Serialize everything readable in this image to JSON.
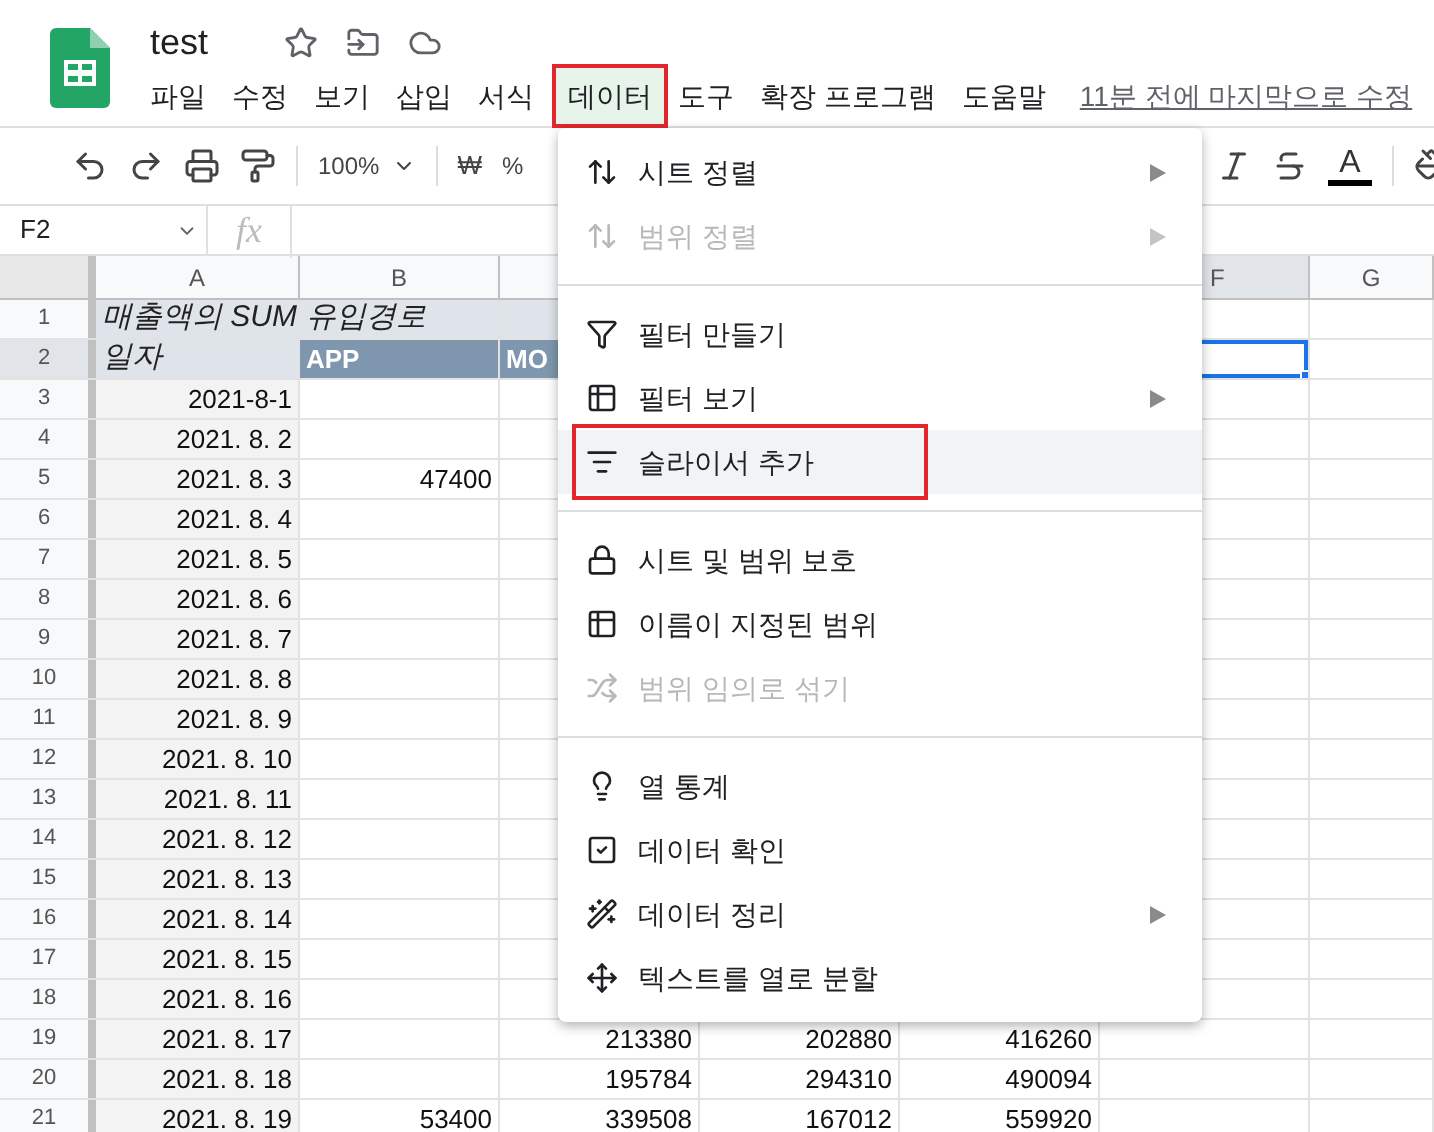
{
  "document": {
    "title": "test",
    "last_edit": "11분 전에 마지막으로 수정"
  },
  "menu_bar": [
    {
      "label": "파일",
      "selected": false,
      "outlined": false
    },
    {
      "label": "수정",
      "selected": false,
      "outlined": false
    },
    {
      "label": "보기",
      "selected": false,
      "outlined": false
    },
    {
      "label": "삽입",
      "selected": false,
      "outlined": false
    },
    {
      "label": "서식",
      "selected": false,
      "outlined": false
    },
    {
      "label": "데이터",
      "selected": true,
      "outlined": true
    },
    {
      "label": "도구",
      "selected": false,
      "outlined": false
    },
    {
      "label": "확장 프로그램",
      "selected": false,
      "outlined": false
    },
    {
      "label": "도움말",
      "selected": false,
      "outlined": false
    }
  ],
  "toolbar": {
    "zoom": "100%",
    "currency": "₩",
    "percent": "%",
    "text_color": "A"
  },
  "formula_bar": {
    "name_box": "F2",
    "fx": "fx"
  },
  "column_headers": {
    "left": [
      "A",
      "B"
    ],
    "right": [
      "F",
      "G"
    ]
  },
  "rows": [
    {
      "number": "1",
      "kind": "pivot-title",
      "cells": {
        "A": "매출액의 SUM",
        "B": "유입경로"
      }
    },
    {
      "number": "2",
      "kind": "pivot-header",
      "selected": {
        "F": true
      },
      "cells": {
        "A": "일자",
        "B": "APP",
        "C": "MO"
      }
    },
    {
      "number": "3",
      "kind": "data",
      "cells": {
        "A": "2021-8-1"
      }
    },
    {
      "number": "4",
      "kind": "data",
      "cells": {
        "A": "2021. 8. 2"
      }
    },
    {
      "number": "5",
      "kind": "data",
      "cells": {
        "A": "2021. 8. 3",
        "B": "47400"
      }
    },
    {
      "number": "6",
      "kind": "data",
      "cells": {
        "A": "2021. 8. 4"
      }
    },
    {
      "number": "7",
      "kind": "data",
      "cells": {
        "A": "2021. 8. 5"
      }
    },
    {
      "number": "8",
      "kind": "data",
      "cells": {
        "A": "2021. 8. 6"
      }
    },
    {
      "number": "9",
      "kind": "data",
      "cells": {
        "A": "2021. 8. 7"
      }
    },
    {
      "number": "10",
      "kind": "data",
      "cells": {
        "A": "2021. 8. 8"
      }
    },
    {
      "number": "11",
      "kind": "data",
      "cells": {
        "A": "2021. 8. 9"
      }
    },
    {
      "number": "12",
      "kind": "data",
      "cells": {
        "A": "2021. 8. 10"
      }
    },
    {
      "number": "13",
      "kind": "data",
      "cells": {
        "A": "2021. 8. 11"
      }
    },
    {
      "number": "14",
      "kind": "data",
      "cells": {
        "A": "2021. 8. 12"
      }
    },
    {
      "number": "15",
      "kind": "data",
      "cells": {
        "A": "2021. 8. 13"
      }
    },
    {
      "number": "16",
      "kind": "data",
      "cells": {
        "A": "2021. 8. 14"
      }
    },
    {
      "number": "17",
      "kind": "data",
      "cells": {
        "A": "2021. 8. 15"
      }
    },
    {
      "number": "18",
      "kind": "data",
      "cells": {
        "A": "2021. 8. 16"
      }
    },
    {
      "number": "19",
      "kind": "data",
      "cells": {
        "A": "2021. 8. 17",
        "C": "213380",
        "D": "202880",
        "E": "416260"
      }
    },
    {
      "number": "20",
      "kind": "data",
      "cells": {
        "A": "2021. 8. 18",
        "C": "195784",
        "D": "294310",
        "E": "490094"
      }
    },
    {
      "number": "21",
      "kind": "data",
      "cells": {
        "A": "2021. 8. 19",
        "B": "53400",
        "C": "339508",
        "D": "167012",
        "E": "559920"
      }
    }
  ],
  "data_menu": {
    "groups": [
      {
        "items": [
          {
            "label": "시트 정렬",
            "kind": "sort",
            "submenu": true,
            "disabled": false,
            "selected": false,
            "outlined": false
          },
          {
            "label": "범위 정렬",
            "kind": "sort",
            "submenu": true,
            "disabled": true,
            "selected": false,
            "outlined": false
          }
        ]
      },
      {
        "items": [
          {
            "label": "필터 만들기",
            "kind": "filter",
            "submenu": false,
            "disabled": false,
            "selected": false,
            "outlined": false
          },
          {
            "label": "필터 보기",
            "kind": "filter-views",
            "submenu": true,
            "disabled": false,
            "selected": false,
            "outlined": false
          },
          {
            "label": "슬라이서 추가",
            "kind": "slicer",
            "submenu": false,
            "disabled": false,
            "selected": true,
            "outlined": true
          }
        ]
      },
      {
        "items": [
          {
            "label": "시트 및 범위 보호",
            "kind": "lock",
            "submenu": false,
            "disabled": false,
            "selected": false,
            "outlined": false
          },
          {
            "label": "이름이 지정된 범위",
            "kind": "named-range",
            "submenu": false,
            "disabled": false,
            "selected": false,
            "outlined": false
          },
          {
            "label": "범위 임의로 섞기",
            "kind": "shuffle",
            "submenu": false,
            "disabled": true,
            "selected": false,
            "outlined": false
          }
        ]
      },
      {
        "items": [
          {
            "label": "열 통계",
            "kind": "stats",
            "submenu": false,
            "disabled": false,
            "selected": false,
            "outlined": false
          },
          {
            "label": "데이터 확인",
            "kind": "validation",
            "submenu": false,
            "disabled": false,
            "selected": false,
            "outlined": false
          },
          {
            "label": "데이터 정리",
            "kind": "cleanup",
            "submenu": true,
            "disabled": false,
            "selected": false,
            "outlined": false
          },
          {
            "label": "텍스트를 열로 분할",
            "kind": "split",
            "submenu": false,
            "disabled": false,
            "selected": false,
            "outlined": false
          }
        ]
      }
    ]
  }
}
